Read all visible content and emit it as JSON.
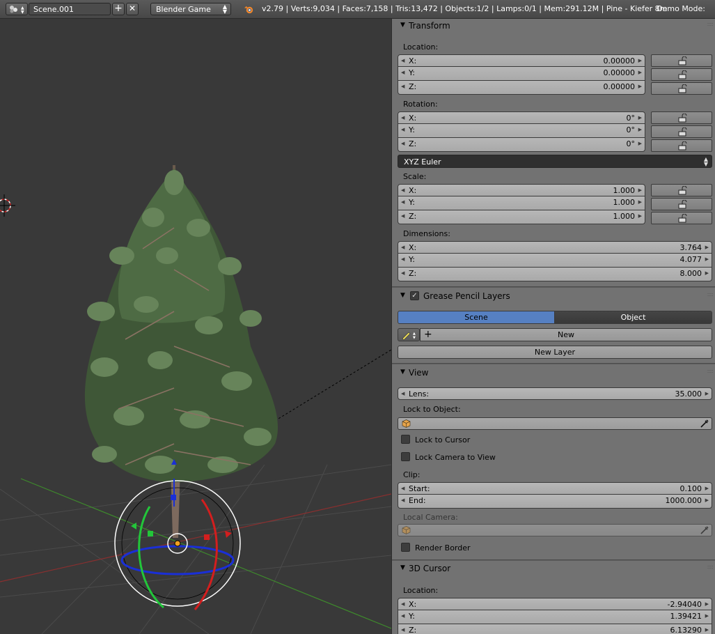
{
  "topbar": {
    "scene_name": "Scene.001",
    "add_icon": "plus-icon",
    "close_icon": "close-icon",
    "engine": "Blender Game",
    "stats": "v2.79 | Verts:9,034 | Faces:7,158 | Tris:13,472 | Objects:1/2 | Lamps:0/1 | Mem:291.12M | Pine - Kiefer 8m",
    "demo_mode": "Demo Mode:"
  },
  "transform": {
    "title": "Transform",
    "location_label": "Location:",
    "location": [
      {
        "axis": "X:",
        "value": "0.00000"
      },
      {
        "axis": "Y:",
        "value": "0.00000"
      },
      {
        "axis": "Z:",
        "value": "0.00000"
      }
    ],
    "rotation_label": "Rotation:",
    "rotation": [
      {
        "axis": "X:",
        "value": "0°"
      },
      {
        "axis": "Y:",
        "value": "0°"
      },
      {
        "axis": "Z:",
        "value": "0°"
      }
    ],
    "rotation_mode": "XYZ Euler",
    "scale_label": "Scale:",
    "scale": [
      {
        "axis": "X:",
        "value": "1.000"
      },
      {
        "axis": "Y:",
        "value": "1.000"
      },
      {
        "axis": "Z:",
        "value": "1.000"
      }
    ],
    "dimensions_label": "Dimensions:",
    "dimensions": [
      {
        "axis": "X:",
        "value": "3.764"
      },
      {
        "axis": "Y:",
        "value": "4.077"
      },
      {
        "axis": "Z:",
        "value": "8.000"
      }
    ]
  },
  "grease_pencil": {
    "title": "Grease Pencil Layers",
    "tab_scene": "Scene",
    "tab_object": "Object",
    "new_label": "New",
    "new_layer_label": "New Layer",
    "active_tab_color": "#5680c2"
  },
  "view": {
    "title": "View",
    "lens_label": "Lens:",
    "lens_value": "35.000",
    "lock_to_object_label": "Lock to Object:",
    "lock_to_cursor": "Lock to Cursor",
    "lock_camera_to_view": "Lock Camera to View",
    "clip_label": "Clip:",
    "clip_start_label": "Start:",
    "clip_start_value": "0.100",
    "clip_end_label": "End:",
    "clip_end_value": "1000.000",
    "local_camera_label": "Local Camera:",
    "render_border": "Render Border"
  },
  "cursor3d": {
    "title": "3D Cursor",
    "location_label": "Location:",
    "location": [
      {
        "axis": "X:",
        "value": "-2.94040"
      },
      {
        "axis": "Y:",
        "value": "1.39421"
      },
      {
        "axis": "Z:",
        "value": "6.13290"
      }
    ]
  }
}
